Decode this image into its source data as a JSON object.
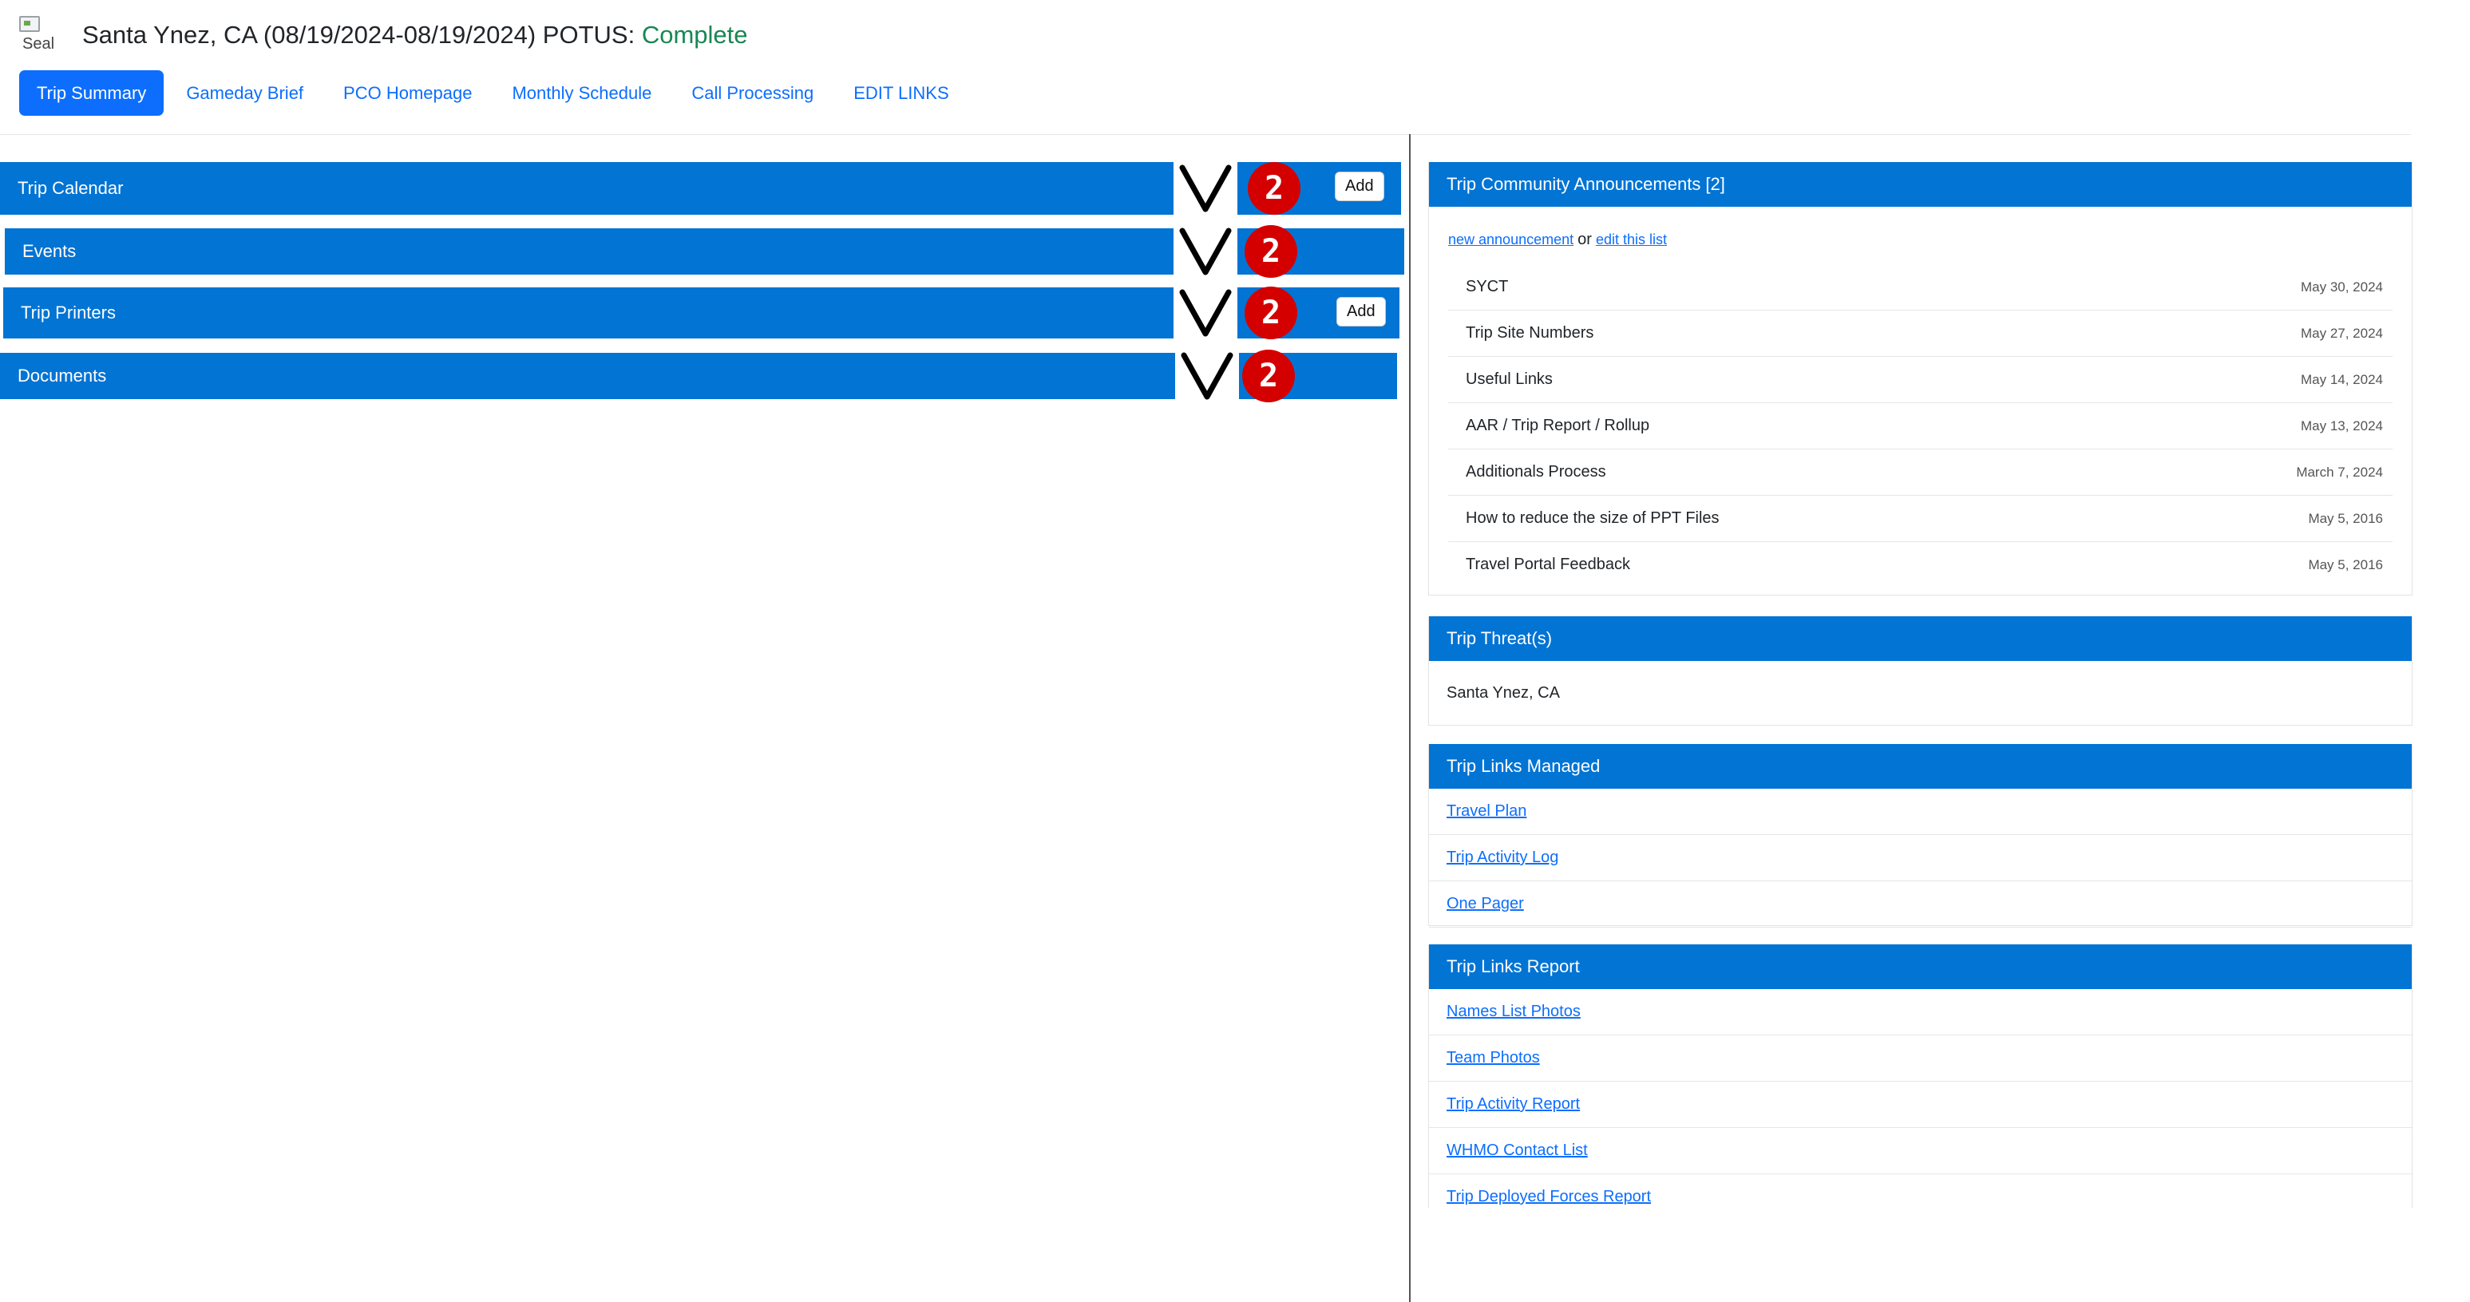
{
  "header": {
    "seal_alt": "Seal",
    "title_prefix": "Santa Ynez, CA (08/19/2024-08/19/2024) POTUS: ",
    "status": "Complete",
    "status_color": "#198754"
  },
  "nav": {
    "tabs": [
      {
        "label": "Trip Summary",
        "active": true
      },
      {
        "label": "Gameday Brief"
      },
      {
        "label": "PCO Homepage"
      },
      {
        "label": "Monthly Schedule"
      },
      {
        "label": "Call Processing"
      },
      {
        "label": "EDIT LINKS"
      }
    ]
  },
  "sections": [
    {
      "label": "Trip Calendar",
      "badge": "2",
      "add_label": "Add"
    },
    {
      "label": "Events",
      "badge": "2"
    },
    {
      "label": "Trip Printers",
      "badge": "2",
      "add_label": "Add"
    },
    {
      "label": "Documents",
      "badge": "2"
    }
  ],
  "announcements": {
    "title": "Trip Community Announcements [2]",
    "new_link": "new announcement",
    "or_text": "or",
    "edit_link": "edit this list",
    "items": [
      {
        "title": "SYCT",
        "date": "May 30, 2024"
      },
      {
        "title": "Trip Site Numbers",
        "date": "May 27, 2024"
      },
      {
        "title": "Useful Links",
        "date": "May 14, 2024"
      },
      {
        "title": "AAR / Trip Report / Rollup",
        "date": "May 13, 2024"
      },
      {
        "title": "Additionals Process",
        "date": "March 7, 2024"
      },
      {
        "title": "How to reduce the size of PPT Files",
        "date": "May 5, 2016"
      },
      {
        "title": "Travel Portal Feedback",
        "date": "May 5, 2016"
      }
    ]
  },
  "threats": {
    "title": "Trip Threat(s)",
    "value": "Santa Ynez, CA"
  },
  "links_managed": {
    "title": "Trip Links Managed",
    "items": [
      "Travel Plan",
      "Trip Activity Log",
      "One Pager"
    ]
  },
  "links_report": {
    "title": "Trip Links Report",
    "items": [
      "Names List Photos",
      "Team Photos",
      "Trip Activity Report",
      "WHMO Contact List",
      "Trip Deployed Forces Report"
    ]
  },
  "colors": {
    "bar_blue": "#0274d4",
    "tab_active": "#0d6efd",
    "badge_red": "#d40000"
  },
  "icons": {
    "chevron": "v-shaped-chevron-icon",
    "badge": "red-circle-number-badge"
  }
}
